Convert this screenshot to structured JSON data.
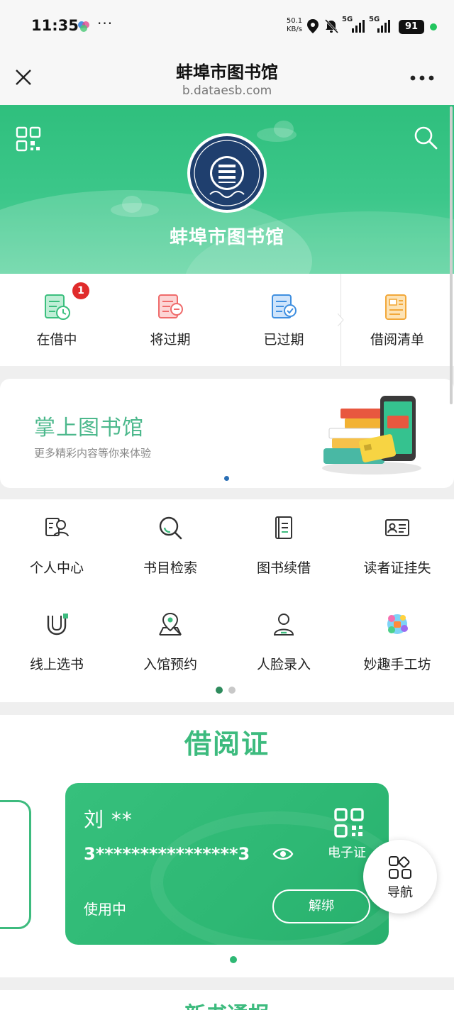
{
  "status_bar": {
    "time": "11:35",
    "more": "···",
    "net_speed_value": "50.1",
    "net_speed_unit": "KB/s",
    "signal1": "5G",
    "signal2": "5G",
    "battery": "91"
  },
  "title_bar": {
    "title": "蚌埠市图书馆",
    "url": "b.dataesb.com"
  },
  "hero": {
    "title": "蚌埠市图书馆",
    "logo_text": "蚌埠市图书馆"
  },
  "loan_status": [
    {
      "label": "在借中",
      "icon": "borrowing-icon",
      "badge": "1",
      "color": "#3bbf7e"
    },
    {
      "label": "将过期",
      "icon": "expiring-icon",
      "color": "#ef6b6b"
    },
    {
      "label": "已过期",
      "icon": "expired-icon",
      "color": "#3f8fe0"
    },
    {
      "label": "借阅清单",
      "icon": "borrow-list-icon",
      "color": "#f2a83a"
    }
  ],
  "banner": {
    "title": "掌上图书馆",
    "subtitle": "更多精彩内容等你来体验"
  },
  "functions": [
    {
      "label": "个人中心",
      "icon": "personal-center-icon"
    },
    {
      "label": "书目检索",
      "icon": "catalog-search-icon"
    },
    {
      "label": "图书续借",
      "icon": "book-renew-icon"
    },
    {
      "label": "读者证挂失",
      "icon": "reader-card-loss-icon"
    },
    {
      "label": "线上选书",
      "icon": "online-book-select-icon"
    },
    {
      "label": "入馆预约",
      "icon": "visit-reservation-icon"
    },
    {
      "label": "人脸录入",
      "icon": "face-enroll-icon"
    },
    {
      "label": "妙趣手工坊",
      "icon": "craft-workshop-icon"
    }
  ],
  "reader_card": {
    "heading": "借阅证",
    "name": "刘 **",
    "number": "3****************3",
    "ecard_label": "电子证",
    "status": "使用中",
    "unbind_label": "解绑"
  },
  "nav_fab": {
    "label": "导航"
  },
  "next_section": {
    "title": "新书通报"
  },
  "colors": {
    "brand_green": "#3dbb7e",
    "badge_red": "#e02b2b"
  }
}
